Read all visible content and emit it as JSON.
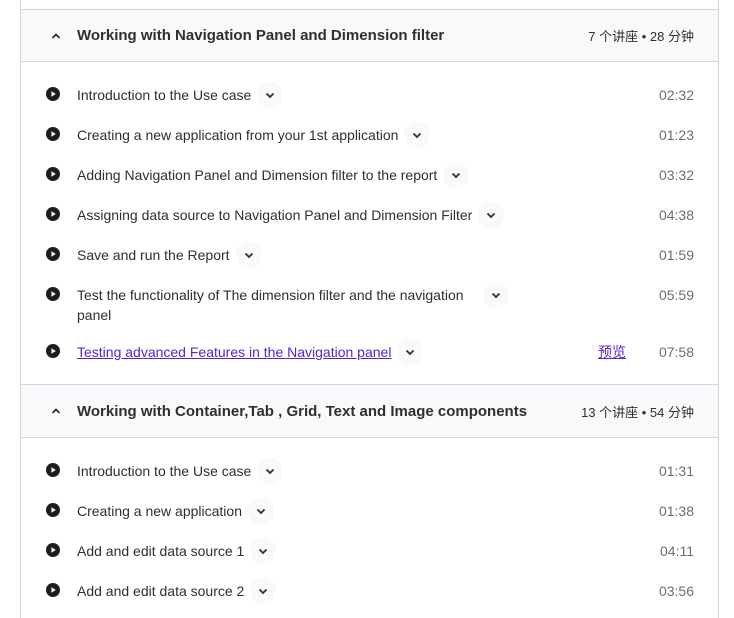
{
  "sections": [
    {
      "title": "Working with Navigation Panel and Dimension filter",
      "meta": "7 个讲座 • 28 分钟",
      "lectures": [
        {
          "title": "Introduction to the Use case",
          "duration": "02:32"
        },
        {
          "title": "Creating a new application from your 1st application",
          "duration": "01:23"
        },
        {
          "title": "Adding Navigation Panel and Dimension filter to the report",
          "duration": "03:32"
        },
        {
          "title": "Assigning data source to Navigation Panel and Dimension Filter",
          "duration": "04:38"
        },
        {
          "title": "Save and run the Report",
          "duration": "01:59"
        },
        {
          "title": "Test the functionality of The dimension filter and the navigation panel",
          "duration": "05:59"
        },
        {
          "title": "Testing advanced Features in the Navigation panel",
          "duration": "07:58",
          "preview": "预览"
        }
      ]
    },
    {
      "title": "Working with Container,Tab , Grid, Text and Image components",
      "meta": "13 个讲座 • 54 分钟",
      "lectures": [
        {
          "title": "Introduction to the Use case",
          "duration": "01:31"
        },
        {
          "title": "Creating a new application",
          "duration": "01:38"
        },
        {
          "title": "Add and edit data source 1",
          "duration": "04:11"
        },
        {
          "title": "Add and edit data source 2",
          "duration": "03:56"
        }
      ]
    }
  ],
  "icons": {
    "section_toggle": "chevron-up-icon",
    "lecture_type": "play-circle-icon",
    "lecture_expand": "chevron-down-icon"
  },
  "colors": {
    "link": "#5624d0",
    "section_bg": "#f7f9fa",
    "border": "#d1d7dc",
    "muted": "#6a6f73"
  }
}
